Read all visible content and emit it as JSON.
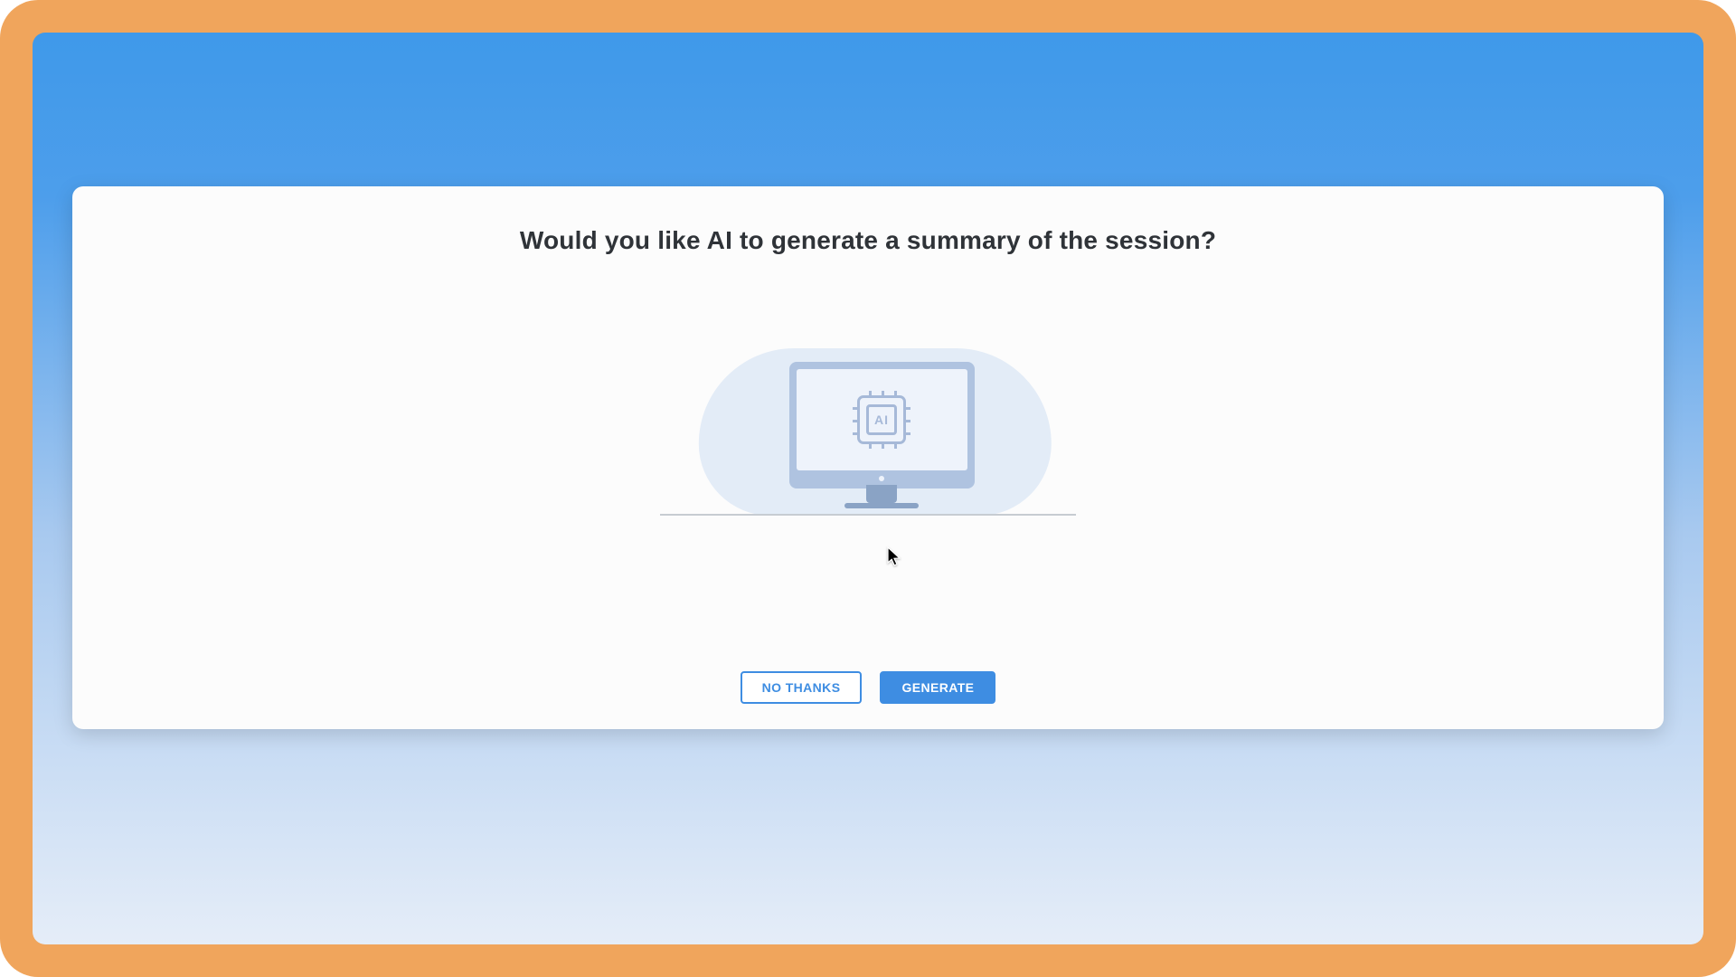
{
  "dialog": {
    "title": "Would you like AI to generate a summary of the session?",
    "chip_label": "AI",
    "buttons": {
      "decline": "NO THANKS",
      "accept": "GENERATE"
    }
  },
  "colors": {
    "frame": "#f0a55c",
    "accent": "#3e8de2"
  }
}
